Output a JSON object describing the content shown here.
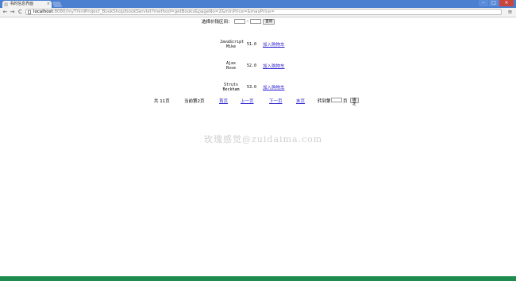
{
  "browser": {
    "tab_title": "书的信息界面",
    "tab_close": "×",
    "url_host": "localhost",
    "url_rest": ":8080/myThirdProject_BookShop/bookServlet?method=getBooks&pageNo=2&minPrice=&maxPrice=",
    "back": "←",
    "forward": "→",
    "reload": "C",
    "menu": "≡",
    "minimize": "–",
    "maximize": "□",
    "close": "×"
  },
  "filter": {
    "label": "选择价钱区间：",
    "separator": "–",
    "submit_label": "查询"
  },
  "books": [
    {
      "title_line1": "JavaScript",
      "title_line2": "Mike",
      "price": "51.0",
      "link": "加入购物车"
    },
    {
      "title_line1": "Ajax",
      "title_line2": "Rose",
      "price": "52.0",
      "link": "加入购物车"
    },
    {
      "title_line1": "Struts",
      "title_line2": "Beckham",
      "price": "53.0",
      "link": "加入购物车"
    }
  ],
  "pager": {
    "total": "共 11页",
    "current": "当前第2页",
    "first": "首页",
    "prev": "上一页",
    "next": "下一页",
    "last": "末页",
    "jump_label": "转到第",
    "jump_suffix": "页",
    "confirm": "确定"
  },
  "watermark": "玫瑰感觉@zuidaima.com",
  "colors": {
    "titlebar": "#4b7fd0",
    "link": "#2a1fd0",
    "taskbar": "#1e8c4f"
  }
}
